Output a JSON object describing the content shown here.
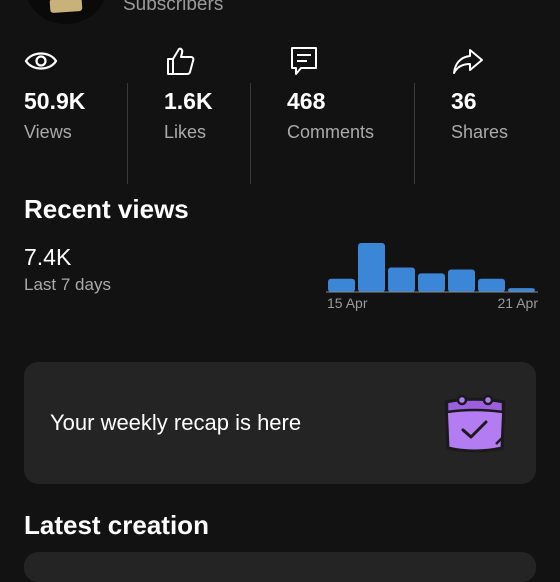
{
  "header": {
    "subscribers_label": "Subscribers"
  },
  "stats": [
    {
      "icon": "eye-icon",
      "value": "50.9K",
      "label": "Views"
    },
    {
      "icon": "thumbs-up-icon",
      "value": "1.6K",
      "label": "Likes"
    },
    {
      "icon": "comment-icon",
      "value": "468",
      "label": "Comments"
    },
    {
      "icon": "share-icon",
      "value": "36",
      "label": "Shares"
    }
  ],
  "recent_views": {
    "title": "Recent views",
    "value": "7.4K",
    "period": "Last 7 days",
    "start_label": "15 Apr",
    "end_label": "21 Apr",
    "bar_color": "#3b86d6",
    "bars": [
      0.27,
      1.0,
      0.5,
      0.38,
      0.46,
      0.27,
      0.08
    ]
  },
  "recap": {
    "text": "Your weekly recap is here",
    "icon": "calendar-check-icon",
    "accent": "#b47cf2"
  },
  "latest": {
    "title": "Latest creation"
  }
}
